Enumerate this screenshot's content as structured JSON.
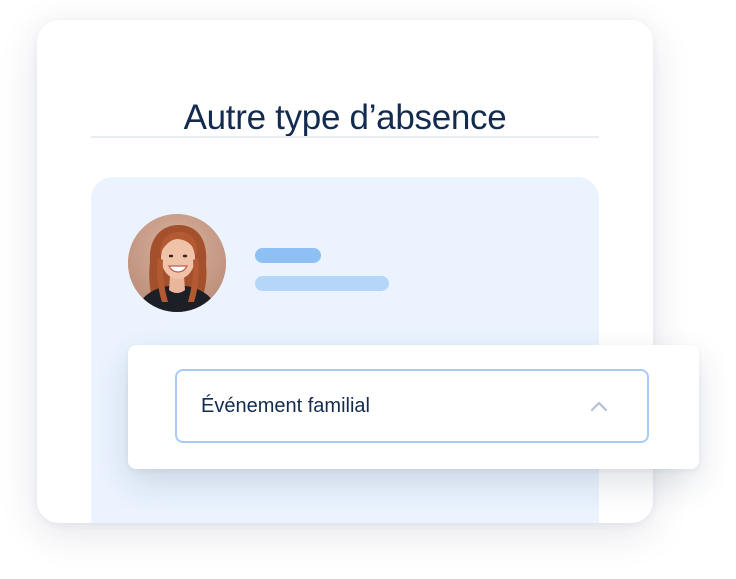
{
  "card": {
    "title": "Autre type d’absence"
  },
  "profile": {
    "avatar_alt": "photo de profil"
  },
  "dropdown": {
    "selected_value": "Événement familial",
    "expanded": true,
    "chevron_icon": "chevron-up-icon"
  },
  "colors": {
    "title_text": "#132b4f",
    "panel_bg": "#eaf3fe",
    "select_border": "#a8cbf6",
    "skeleton_dark": "#8ec0f6",
    "skeleton_light": "#b6d6f9"
  }
}
